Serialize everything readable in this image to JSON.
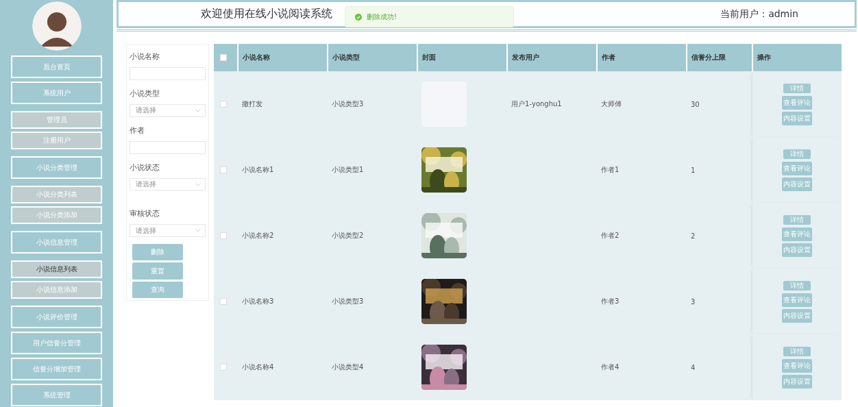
{
  "header": {
    "title": "欢迎使用在线小说阅读系统",
    "current_user": "当前用户：admin"
  },
  "toast": {
    "kind": "success",
    "message": "删除成功!"
  },
  "sidebar": {
    "items": [
      {
        "label": "后台首页",
        "kind": "group",
        "selected": false
      },
      {
        "label": "系统用户",
        "kind": "group",
        "selected": false
      },
      {
        "label": "管理员",
        "kind": "sub",
        "selected": false
      },
      {
        "label": "注册用户",
        "kind": "sub",
        "selected": false
      },
      {
        "label": "小说分类管理",
        "kind": "group",
        "selected": false
      },
      {
        "label": "小说分类列表",
        "kind": "sub",
        "selected": false
      },
      {
        "label": "小说分类添加",
        "kind": "sub",
        "selected": false
      },
      {
        "label": "小说信息管理",
        "kind": "group",
        "selected": false
      },
      {
        "label": "小说信息列表",
        "kind": "sub",
        "selected": true
      },
      {
        "label": "小说信息添加",
        "kind": "sub",
        "selected": false
      },
      {
        "label": "小说评价管理",
        "kind": "group",
        "selected": false
      },
      {
        "label": "用户信誉分管理",
        "kind": "group",
        "selected": false
      },
      {
        "label": "信誉分增加管理",
        "kind": "group",
        "selected": false
      },
      {
        "label": "系统管理",
        "kind": "group",
        "selected": false
      }
    ]
  },
  "filters": {
    "fields": [
      {
        "label": "小说名称",
        "kind": "text"
      },
      {
        "label": "小说类型",
        "kind": "select",
        "placeholder": "请选择"
      },
      {
        "label": "作者",
        "kind": "text"
      },
      {
        "label": "小说状态",
        "kind": "select",
        "placeholder": "请选择"
      },
      {
        "label": "审核状态",
        "kind": "select",
        "placeholder": "请选择"
      }
    ],
    "buttons": [
      "删除",
      "重置",
      "查询"
    ]
  },
  "table": {
    "all_checked": false,
    "columns": [
      "小说名称",
      "小说类型",
      "封面",
      "发布用户",
      "作者",
      "信誉分上限",
      "操作"
    ],
    "rows": [
      {
        "checked": false,
        "name": "撒打发",
        "type": "小说类型3",
        "cover": {
          "kind": "empty"
        },
        "user": "用户1-yonghu1",
        "author": "大师傅",
        "credit": "30",
        "actions": [
          "详情",
          "查看评论",
          "内容设置"
        ]
      },
      {
        "checked": false,
        "name": "小说名称1",
        "type": "小说类型1",
        "author": "作者1",
        "credit": "1",
        "actions": [
          "详情",
          "查看评论",
          "内容设置"
        ]
      },
      {
        "checked": false,
        "name": "小说名称2",
        "type": "小说类型2",
        "author": "作者2",
        "credit": "2",
        "actions": [
          "详情",
          "查看评论",
          "内容设置"
        ]
      },
      {
        "checked": false,
        "name": "小说名称3",
        "type": "小说类型3",
        "author": "作者3",
        "credit": "3",
        "actions": [
          "详情",
          "查看评论",
          "内容设置"
        ]
      },
      {
        "checked": false,
        "name": "小说名称4",
        "type": "小说类型4",
        "author": "作者4",
        "credit": "4",
        "actions": [
          "详情",
          "查看评论",
          "内容设置"
        ]
      }
    ]
  }
}
